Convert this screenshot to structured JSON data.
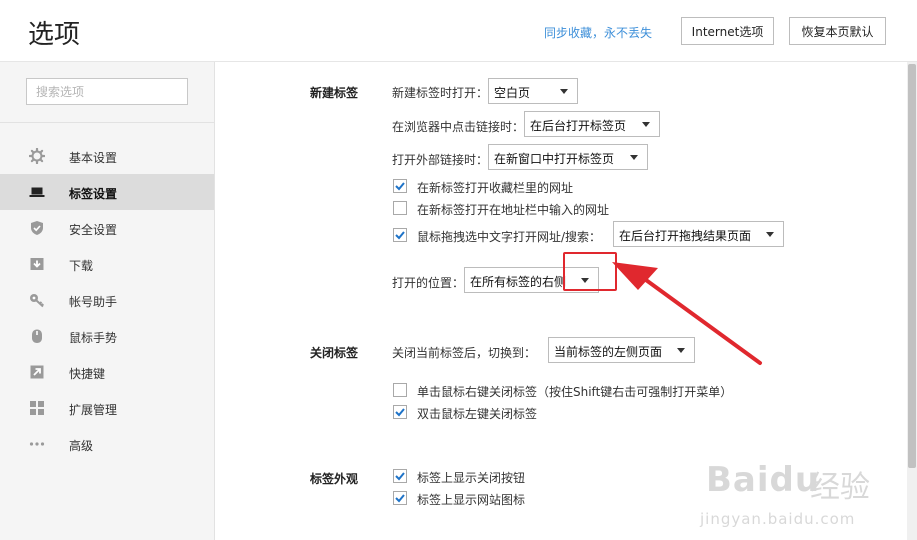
{
  "header": {
    "title": "选项",
    "sync_link": "同步收藏，永不丢失",
    "internet_button": "Internet选项",
    "restore_button": "恢复本页默认"
  },
  "sidebar": {
    "search_placeholder": "搜索选项",
    "items": [
      {
        "label": "基本设置",
        "icon": "gear-icon"
      },
      {
        "label": "标签设置",
        "icon": "laptop-icon",
        "active": true
      },
      {
        "label": "安全设置",
        "icon": "shield-icon"
      },
      {
        "label": "下载",
        "icon": "download-icon"
      },
      {
        "label": "帐号助手",
        "icon": "key-icon"
      },
      {
        "label": "鼠标手势",
        "icon": "mouse-icon"
      },
      {
        "label": "快捷键",
        "icon": "shortcut-icon"
      },
      {
        "label": "扩展管理",
        "icon": "grid-icon"
      },
      {
        "label": "高级",
        "icon": "more-icon"
      }
    ]
  },
  "sections": {
    "new_tab": {
      "title": "新建标签",
      "open_new_tab_label": "新建标签时打开：",
      "open_new_tab_value": "空白页",
      "click_link_label": "在浏览器中点击链接时：",
      "click_link_value": "在后台打开标签页",
      "external_link_label": "打开外部链接时：",
      "external_link_value": "在新窗口中打开标签页",
      "cb_favorites": "在新标签打开收藏栏里的网址",
      "cb_addressbar": "在新标签打开在地址栏中输入的网址",
      "cb_drag": "鼠标拖拽选中文字打开网址/搜索：",
      "drag_value": "在后台打开拖拽结果页面",
      "position_label": "打开的位置：",
      "position_value": "在所有标签的右侧"
    },
    "close_tab": {
      "title": "关闭标签",
      "switch_label": "关闭当前标签后，切换到：",
      "switch_value": "当前标签的左侧页面",
      "cb_right_click": "单击鼠标右键关闭标签（按住Shift键右击可强制打开菜单）",
      "cb_double_click": "双击鼠标左键关闭标签"
    },
    "tab_look": {
      "title": "标签外观",
      "cb_close_button": "标签上显示关闭按钮",
      "cb_site_icon": "标签上显示网站图标"
    }
  },
  "checkbox_state": {
    "favorites": true,
    "addressbar": false,
    "drag": true,
    "right_click": false,
    "double_click": true,
    "close_button": true,
    "site_icon": true
  },
  "watermark": {
    "brand": "Baidu",
    "brand_cn": "经验",
    "url": "jingyan.baidu.com"
  },
  "colors": {
    "accent_link": "#3d8fd9",
    "annotation_red": "#e0282e",
    "checkbox_blue": "#1e73c8"
  }
}
